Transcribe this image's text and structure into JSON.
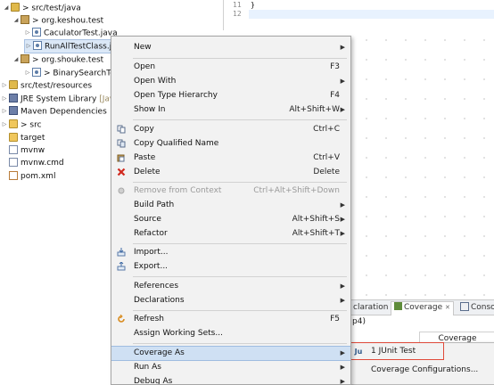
{
  "tree": {
    "items": [
      {
        "label": "src/test/java",
        "prefix": "> "
      },
      {
        "label": "org.keshou.test",
        "prefix": "> "
      },
      {
        "label": "CaculatorTest.java",
        "prefix": ""
      },
      {
        "label": "RunAllTestClass.ja",
        "prefix": ""
      },
      {
        "label": "org.shouke.test",
        "prefix": "> "
      },
      {
        "label": "BinarySearchTe",
        "prefix": "> "
      },
      {
        "label": "src/test/resources",
        "prefix": ""
      },
      {
        "label": "JRE System Library",
        "suffix": "[Jav"
      },
      {
        "label": "Maven Dependencies",
        "prefix": ""
      },
      {
        "label": "src",
        "prefix": "> "
      },
      {
        "label": "target",
        "prefix": ""
      },
      {
        "label": "mvnw",
        "prefix": ""
      },
      {
        "label": "mvnw.cmd",
        "prefix": ""
      },
      {
        "label": "pom.xml",
        "prefix": ""
      }
    ]
  },
  "editor": {
    "lines": [
      {
        "num": "11",
        "code": "}"
      },
      {
        "num": "12",
        "code": ""
      }
    ]
  },
  "context_menu": {
    "items": [
      {
        "label": "New",
        "shortcut": "",
        "submenu": true
      },
      {
        "label": "Open",
        "shortcut": "F3"
      },
      {
        "label": "Open With",
        "shortcut": "",
        "submenu": true
      },
      {
        "label": "Open Type Hierarchy",
        "shortcut": "F4"
      },
      {
        "label": "Show In",
        "shortcut": "Alt+Shift+W",
        "submenu": true
      },
      {
        "label": "Copy",
        "shortcut": "Ctrl+C",
        "icon": "copy-icon"
      },
      {
        "label": "Copy Qualified Name",
        "shortcut": "",
        "icon": "copy-qualified-icon"
      },
      {
        "label": "Paste",
        "shortcut": "Ctrl+V",
        "icon": "paste-icon"
      },
      {
        "label": "Delete",
        "shortcut": "Delete",
        "icon": "delete-icon"
      },
      {
        "label": "Remove from Context",
        "shortcut": "Ctrl+Alt+Shift+Down",
        "disabled": true,
        "icon": "remove-context-icon"
      },
      {
        "label": "Build Path",
        "shortcut": "",
        "submenu": true
      },
      {
        "label": "Source",
        "shortcut": "Alt+Shift+S",
        "submenu": true
      },
      {
        "label": "Refactor",
        "shortcut": "Alt+Shift+T",
        "submenu": true
      },
      {
        "label": "Import...",
        "shortcut": "",
        "icon": "import-icon"
      },
      {
        "label": "Export...",
        "shortcut": "",
        "icon": "export-icon"
      },
      {
        "label": "References",
        "shortcut": "",
        "submenu": true
      },
      {
        "label": "Declarations",
        "shortcut": "",
        "submenu": true
      },
      {
        "label": "Refresh",
        "shortcut": "F5",
        "icon": "refresh-icon"
      },
      {
        "label": "Assign Working Sets...",
        "shortcut": ""
      },
      {
        "label": "Coverage As",
        "shortcut": "",
        "submenu": true,
        "highlighted": true
      },
      {
        "label": "Run As",
        "shortcut": "",
        "submenu": true
      },
      {
        "label": "Debug As",
        "shortcut": "",
        "submenu": true
      }
    ]
  },
  "submenu": {
    "items": [
      {
        "label": "1 JUnit Test",
        "icon": "Ju"
      },
      {
        "label": "Coverage Configurations..."
      }
    ]
  },
  "bottom_view": {
    "tabs": [
      {
        "label": "claration"
      },
      {
        "label": "Coverage",
        "close": "✕"
      },
      {
        "label": "Conso"
      }
    ],
    "path_text": "p4)",
    "column_header": "Coverage"
  },
  "colors": {
    "menu_bg": "#f2f2f2",
    "highlight": "#cfe0f3",
    "annotation_red": "#e04a3a"
  }
}
